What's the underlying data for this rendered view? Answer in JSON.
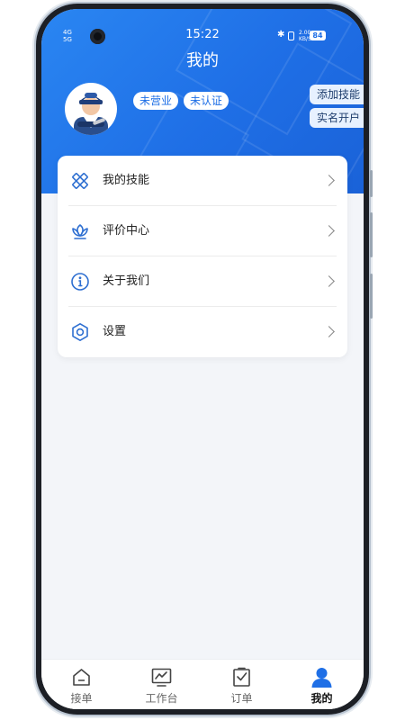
{
  "status_bar": {
    "network": "4G",
    "signal": "5G",
    "time": "15:22",
    "speed_value": "2.00",
    "speed_unit": "KB/S",
    "battery": "84"
  },
  "header": {
    "title": "我的",
    "tags": [
      "未营业",
      "未认证"
    ],
    "actions": [
      "添加技能",
      "实名开户"
    ],
    "accent_color": "#1f6fe6"
  },
  "menu": [
    {
      "label": "我的技能",
      "icon": "pencil-ruler-icon"
    },
    {
      "label": "评价中心",
      "icon": "lotus-icon"
    },
    {
      "label": "关于我们",
      "icon": "info-icon"
    },
    {
      "label": "设置",
      "icon": "gear-icon"
    }
  ],
  "tabbar": {
    "tabs": [
      {
        "label": "接单",
        "icon": "tray-icon"
      },
      {
        "label": "工作台",
        "icon": "monitor-chart-icon"
      },
      {
        "label": "订单",
        "icon": "clipboard-check-icon"
      },
      {
        "label": "我的",
        "icon": "person-icon"
      }
    ],
    "active": "我的"
  }
}
